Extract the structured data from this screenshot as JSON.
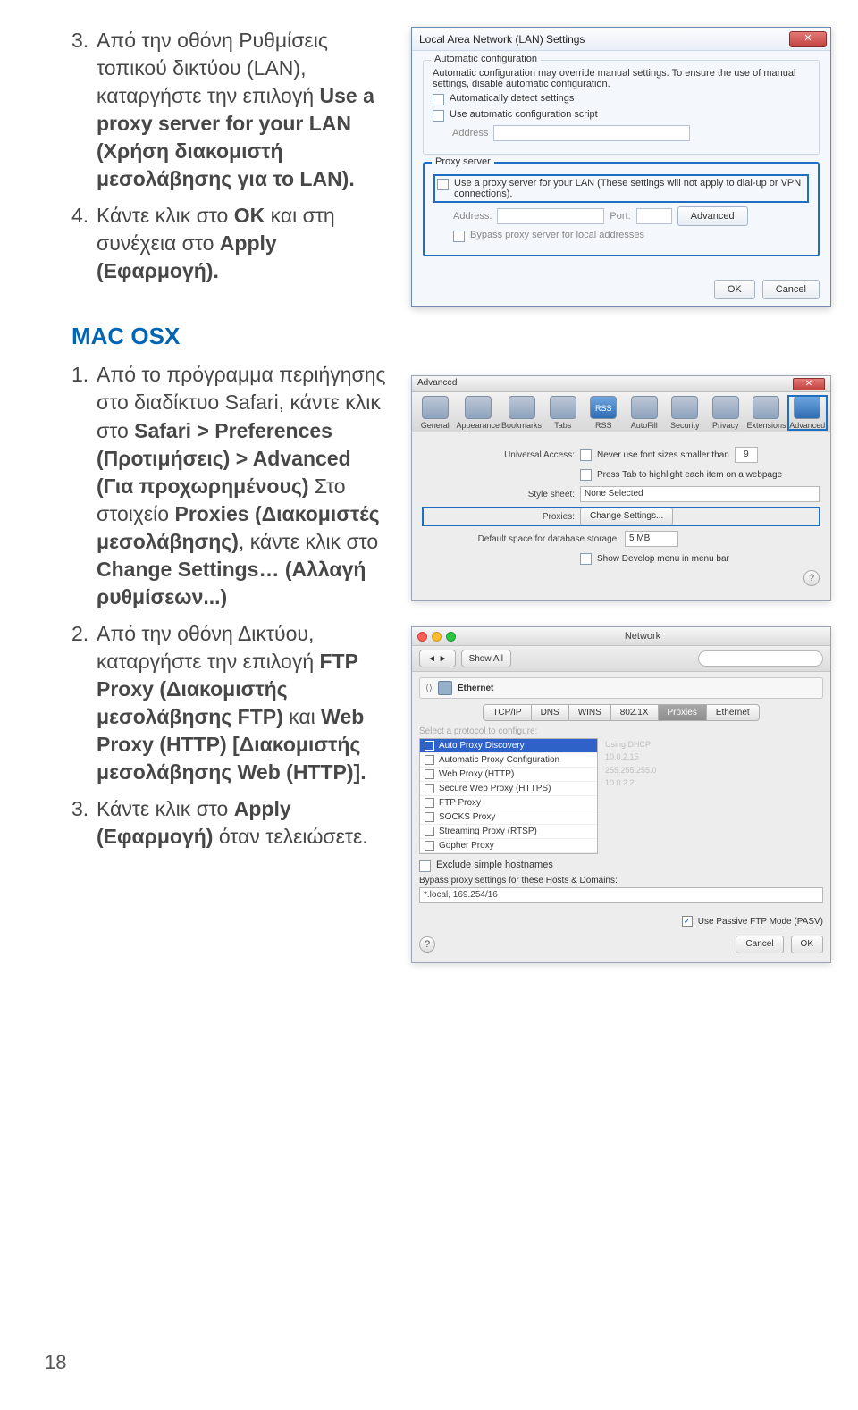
{
  "top": {
    "item3_num": "3.",
    "item3": "Από την οθόνη Ρυθμίσεις τοπικού δικτύου (LAN), καταργήστε την επιλογή ",
    "item3_bold": "Use a proxy server for your LAN (Χρήση διακομιστή μεσολάβησης για το LAN).",
    "item4_num": "4.",
    "item4_a": "Κάντε κλικ στο ",
    "item4_ok": "OK",
    "item4_b": " και στη συνέχεια στο ",
    "item4_apply": "Apply (Εφαρμογή).",
    "heading": "MAC OSX",
    "m1_num": "1.",
    "m1_a": "Από το πρόγραμμα περιήγησης στο διαδίκτυο Safari, κάντε κλικ στο ",
    "m1_b": "Safari > Preferences (Προτιμήσεις) > Advanced (Για προχωρημένους)",
    "m1_c": " Στο στοιχείο ",
    "m1_d": "Proxies (Διακομιστές μεσολάβησης)",
    "m1_e": ", κάντε κλικ στο ",
    "m1_f": "Change Settings… (Αλλαγή ρυθμίσεων...)",
    "m2_num": "2.",
    "m2_a": "Από την οθόνη Δικτύου, καταργήστε την επιλογή ",
    "m2_b": "FTP Proxy (Διακομιστής μεσολάβησης FTP)",
    "m2_c": " και ",
    "m2_d": "Web Proxy (HTTP) [Διακομιστής μεσολάβησης Web (HTTP)].",
    "m3_num": "3.",
    "m3_a": "Κάντε κλικ στο ",
    "m3_b": "Apply (Εφαρμογή)",
    "m3_c": " όταν τελειώσετε."
  },
  "lan": {
    "title": "Local Area Network (LAN) Settings",
    "close": "✕",
    "grp1_legend": "Automatic configuration",
    "grp1_desc": "Automatic configuration may override manual settings. To ensure the use of manual settings, disable automatic configuration.",
    "auto_detect": "Automatically detect settings",
    "auto_script": "Use automatic configuration script",
    "address_lbl": "Address",
    "grp2_legend": "Proxy server",
    "proxy_chk": "Use a proxy server for your LAN (These settings will not apply to dial-up or VPN connections).",
    "addr2": "Address:",
    "port": "Port:",
    "advanced": "Advanced",
    "bypass": "Bypass proxy server for local addresses",
    "ok": "OK",
    "cancel": "Cancel"
  },
  "safari": {
    "title": "Advanced",
    "tabs": [
      "General",
      "Appearance",
      "Bookmarks",
      "Tabs",
      "RSS",
      "AutoFill",
      "Security",
      "Privacy",
      "Extensions",
      "Advanced"
    ],
    "ua_label": "Universal Access:",
    "ua_chk": "Never use font sizes smaller than",
    "ua_val": "9",
    "tab_hl": "Press Tab to highlight each item on a webpage",
    "ss_label": "Style sheet:",
    "ss_val": "None Selected",
    "px_label": "Proxies:",
    "px_btn": "Change Settings...",
    "db_label": "Default space for database storage:",
    "db_val": "5 MB",
    "dev": "Show Develop menu in menu bar",
    "help": "?"
  },
  "net": {
    "title": "Network",
    "back": "◄ ►",
    "showall": "Show All",
    "eth": "Ethernet",
    "tabs": [
      "TCP/IP",
      "DNS",
      "WINS",
      "802.1X",
      "Proxies",
      "Ethernet"
    ],
    "select_proto": "Select a protocol to configure:",
    "protocols": [
      "Auto Proxy Discovery",
      "Automatic Proxy Configuration",
      "Web Proxy (HTTP)",
      "Secure Web Proxy (HTTPS)",
      "FTP Proxy",
      "SOCKS Proxy",
      "Streaming Proxy (RTSP)",
      "Gopher Proxy"
    ],
    "faded": [
      "Using DHCP",
      "10.0.2.15",
      "255.255.255.0",
      "10.0.2.2"
    ],
    "exclude": "Exclude simple hostnames",
    "bypass_lbl": "Bypass proxy settings for these Hosts & Domains:",
    "bypass_val": "*.local, 169.254/16",
    "pasv": "Use Passive FTP Mode (PASV)",
    "help": "?",
    "cancel": "Cancel",
    "ok": "OK"
  },
  "page_number": "18"
}
